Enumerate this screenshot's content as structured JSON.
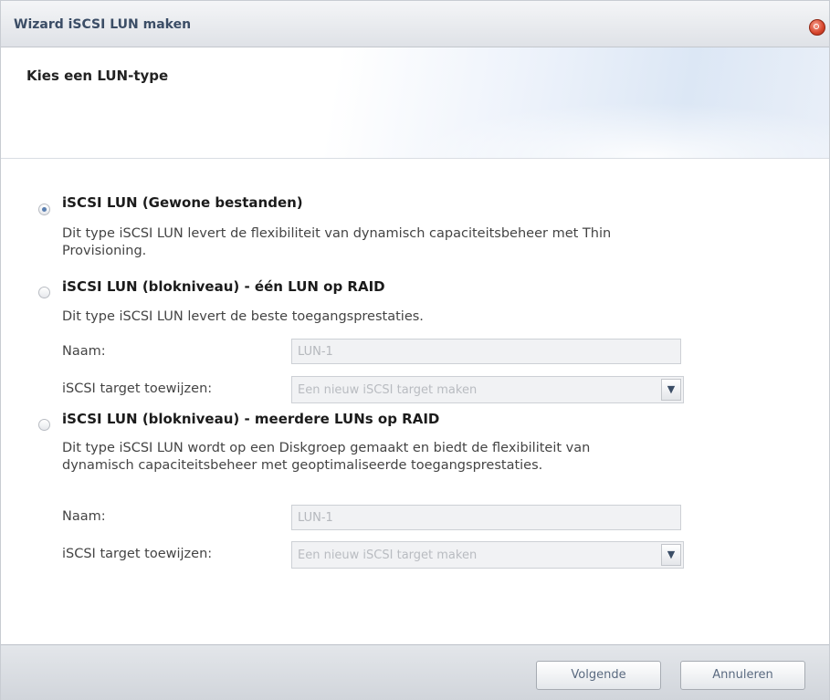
{
  "window": {
    "title": "Wizard iSCSI LUN maken"
  },
  "header": {
    "title": "Kies een LUN-type"
  },
  "options": [
    {
      "title": "iSCSI LUN (Gewone bestanden)",
      "selected": true,
      "description_line1": "Dit type iSCSI LUN levert de flexibiliteit van dynamisch capaciteitsbeheer met Thin",
      "description_line2": "Provisioning."
    },
    {
      "title": "iSCSI LUN (blokniveau) - één LUN op RAID",
      "selected": false,
      "description_line1": "Dit type iSCSI LUN levert de beste toegangsprestaties.",
      "name_label": "Naam:",
      "name_value": "LUN-1",
      "target_label": "iSCSI target toewijzen:",
      "target_value": "Een nieuw iSCSI target maken"
    },
    {
      "title": "iSCSI LUN (blokniveau) - meerdere LUNs op RAID",
      "selected": false,
      "description_line1": "Dit type iSCSI LUN wordt op een Diskgroep gemaakt en biedt de flexibiliteit van",
      "description_line2": "dynamisch capaciteitsbeheer met geoptimaliseerde toegangsprestaties.",
      "name_label": "Naam:",
      "name_value": "LUN-1",
      "target_label": "iSCSI target toewijzen:",
      "target_value": "Een nieuw iSCSI target maken"
    }
  ],
  "footer": {
    "next_label": "Volgende",
    "cancel_label": "Annuleren"
  },
  "icons": {
    "close": "close-icon",
    "dropdown": "chevron-down-icon"
  },
  "colors": {
    "title_text": "#3b4d66",
    "close_button": "#d6442b",
    "radio_selected": "#5a7fb0"
  }
}
